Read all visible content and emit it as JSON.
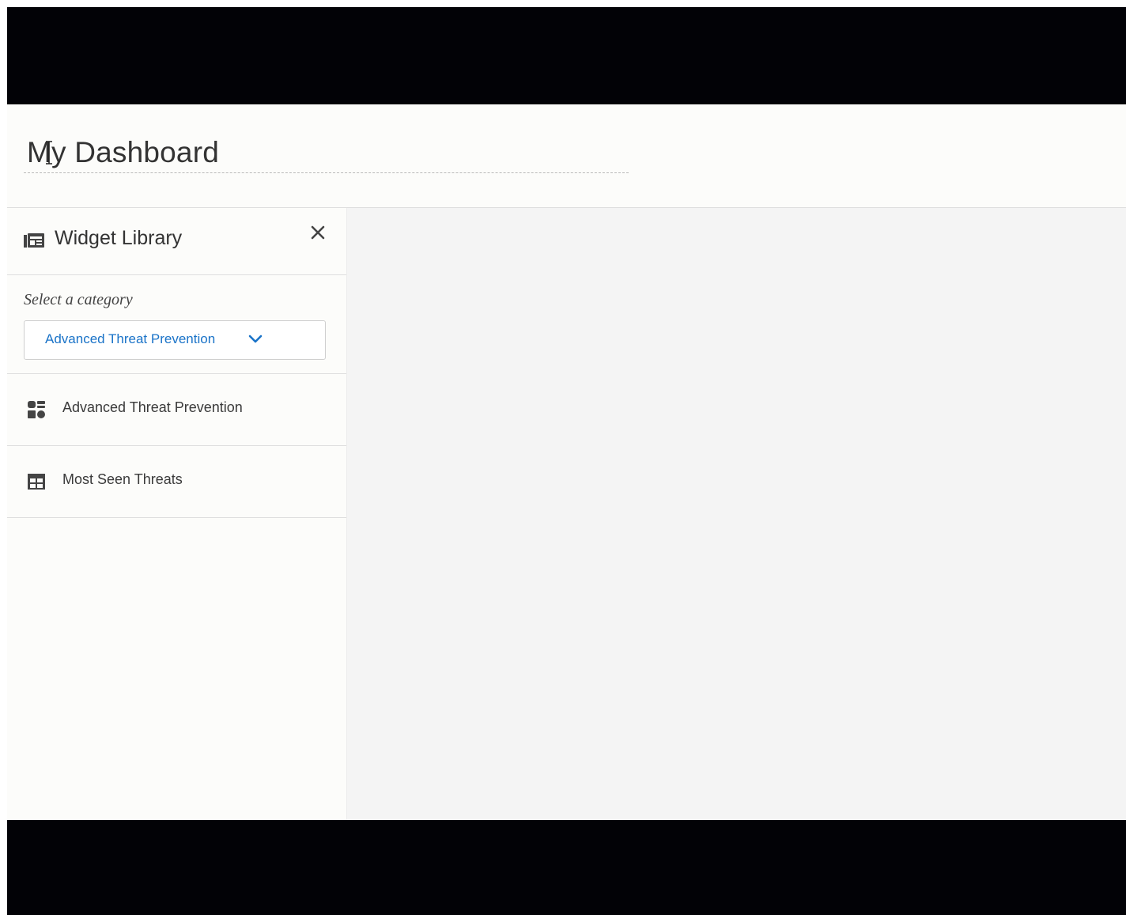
{
  "header": {
    "dashboard_title": "My Dashboard"
  },
  "widget_library": {
    "title": "Widget Library",
    "icon": "widget-library-icon",
    "close_icon": "close-icon",
    "category": {
      "label": "Select a category",
      "selected": "Advanced Threat Prevention",
      "chevron_icon": "chevron-down-icon"
    },
    "items": [
      {
        "label": "Advanced Threat Prevention",
        "icon": "grid-tiles-icon"
      },
      {
        "label": "Most Seen Threats",
        "icon": "table-icon"
      }
    ]
  },
  "colors": {
    "accent": "#1a73c8",
    "letterbox": "#020206",
    "panel_bg": "#fcfcfa",
    "canvas_bg": "#f4f4f4"
  }
}
